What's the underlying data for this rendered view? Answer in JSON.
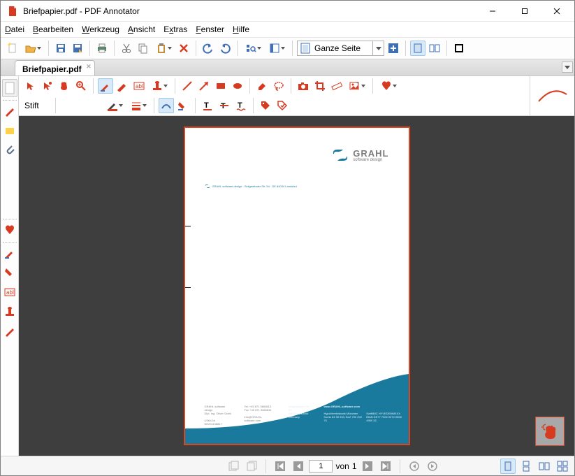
{
  "title": "Briefpapier.pdf - PDF Annotator",
  "menu": {
    "datei": "Datei",
    "bearbeiten": "Bearbeiten",
    "werkzeug": "Werkzeug",
    "ansicht": "Ansicht",
    "extras": "Extras",
    "fenster": "Fenster",
    "hilfe": "Hilfe"
  },
  "tab": {
    "name": "Briefpapier.pdf"
  },
  "zoom": {
    "label": "Ganze Seite"
  },
  "toolrow2": {
    "label": "Stift"
  },
  "page": {
    "logo_line1": "GRAHL",
    "logo_line2": "software design",
    "address_line": "GRAHL software design · Seligenthaler Str. 54 · DE 84034 Landshut",
    "footer": {
      "col1_l1": "GRAHL software design",
      "col1_l2": "Dipl. Ing. Oliver Grahl",
      "col1_l3": "UStId-Nr DE201138817",
      "col2_l1": "Tel. +49 871 9665813",
      "col2_l2": "Fax +49 871 9665831",
      "col2_l3": "info@GRAHL-software.com",
      "col3_l1": "Seligenthaler Str. 54",
      "col3_l2": "84034 Landshut",
      "col3_l3": "Germany",
      "col4_l1": "www.GRAHL-software.com",
      "col5_l1": "HypoVereinsbank München",
      "col5_l2": "Konto 84 95 933, BLZ 700 202 70",
      "col5_l3": "Swift/BIC HYVEDEMMXXX",
      "col5_l4": "IBAN DE77 7002 0270 0008 4959 33"
    }
  },
  "nav": {
    "page_current": "1",
    "page_sep": "von",
    "page_total": "1"
  }
}
